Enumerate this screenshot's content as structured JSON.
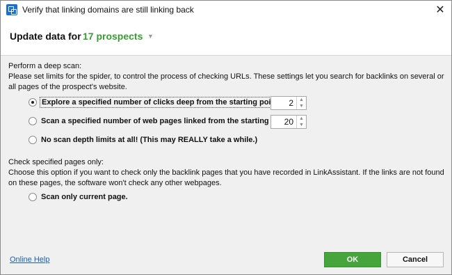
{
  "window": {
    "title": "Verify that linking domains are still linking back",
    "close_glyph": "✕"
  },
  "header": {
    "label": "Update data for",
    "count": "17 prospects",
    "caret_glyph": "▼"
  },
  "deep_scan": {
    "title": "Perform a deep scan:",
    "description": "Please set limits for the spider, to control the process of checking URLs. These settings let you search for backlinks on several or all pages of the prospect's website.",
    "options": [
      {
        "label": "Explore a specified number of clicks deep from the starting point.",
        "checked": true,
        "value": "2"
      },
      {
        "label": "Scan a specified number of web pages linked from the starting point.",
        "checked": false,
        "value": "20"
      },
      {
        "label": "No scan depth limits at all! (This may REALLY take a while.)",
        "checked": false
      }
    ]
  },
  "specified_pages": {
    "title": "Check specified pages only:",
    "description": "Choose this option if you want to check only the backlink pages that you have recorded in LinkAssistant. If the links are not found on these pages, the software won't check any other webpages.",
    "option_label": "Scan only current page.",
    "checked": false
  },
  "footer": {
    "help_link": "Online Help",
    "ok_label": "OK",
    "cancel_label": "Cancel"
  },
  "spinner_glyphs": {
    "up": "▲",
    "down": "▼"
  },
  "colors": {
    "accent_green": "#3a9b34",
    "ok_button": "#46a43c",
    "link": "#1a5fb4"
  }
}
